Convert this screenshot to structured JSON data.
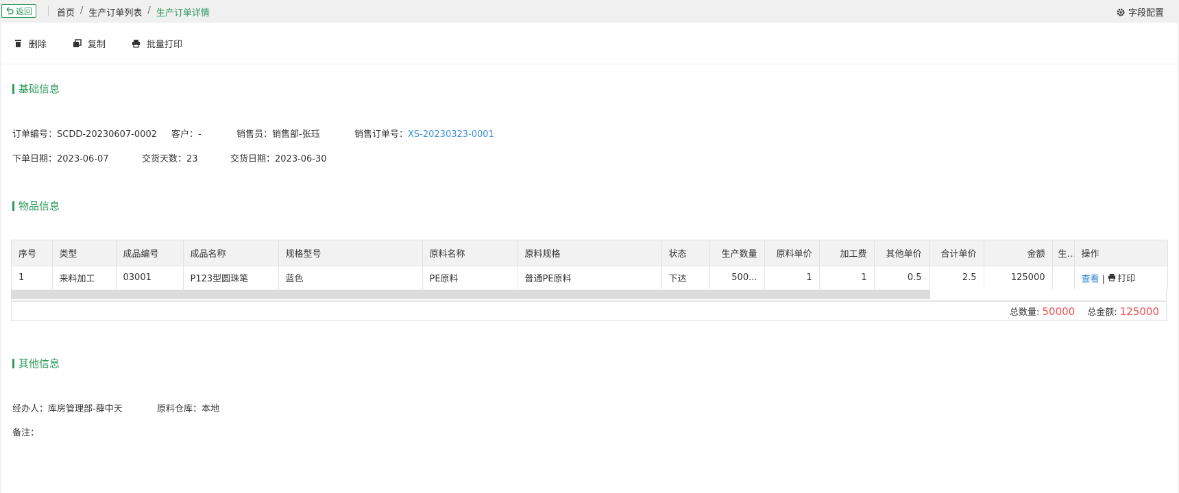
{
  "topbar": {
    "back_label": "返回",
    "breadcrumb": [
      "首页",
      "生产订单列表",
      "生产订单详情"
    ],
    "field_config_label": "字段配置"
  },
  "toolbar": {
    "delete_label": "删除",
    "copy_label": "复制",
    "batch_print_label": "批量打印"
  },
  "sections": {
    "basic": "基础信息",
    "items": "物品信息",
    "other": "其他信息"
  },
  "basic_info": {
    "order_no_label": "订单编号：",
    "order_no": "SCDD-20230607-0002",
    "customer_label": "客户：",
    "customer": "-",
    "salesperson_label": "销售员：",
    "salesperson": "销售部-张珏",
    "sales_order_label": "销售订单号：",
    "sales_order": "XS-20230323-0001",
    "order_date_label": "下单日期：",
    "order_date": "2023-06-07",
    "delivery_days_label": "交货天数：",
    "delivery_days": "23",
    "delivery_date_label": "交货日期：",
    "delivery_date": "2023-06-30"
  },
  "table": {
    "headers": [
      "序号",
      "类型",
      "成品编号",
      "成品名称",
      "规格型号",
      "原料名称",
      "原料规格",
      "状态",
      "生产数量",
      "原料单价",
      "加工费",
      "其他单价",
      "合计单价",
      "金额",
      "生产",
      "操作"
    ],
    "rows": [
      [
        "1",
        "来料加工",
        "03001",
        "P123型圆珠笔",
        "蓝色",
        "PE原料",
        "普通PE原料",
        "下达",
        "500...",
        "1",
        "1",
        "0.5",
        "2.5",
        "125000",
        ""
      ]
    ],
    "op_view": "查看",
    "op_sep": "|",
    "op_print": "打印"
  },
  "totals": {
    "qty_label": "总数量:",
    "qty": "50000",
    "amount_label": "总金额:",
    "amount": "125000"
  },
  "other_info": {
    "handler_label": "经办人：",
    "handler": "库房管理部-薛中天",
    "warehouse_label": "原料仓库：",
    "warehouse": "本地",
    "remark_label": "备注：",
    "remark": ""
  },
  "colors": {
    "accent": "#2e9a5b",
    "link": "#3b8fde",
    "total": "#f05050"
  }
}
